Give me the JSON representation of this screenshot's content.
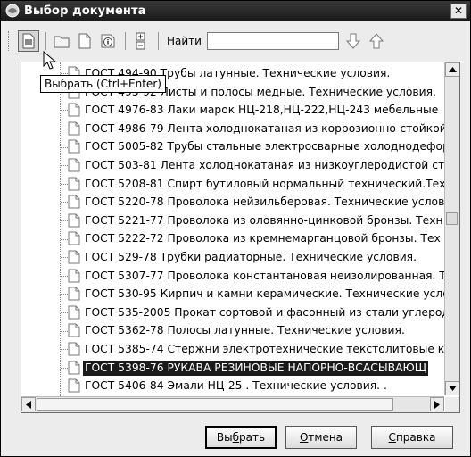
{
  "window": {
    "title": "Выбор документа",
    "close_label": "✕"
  },
  "toolbar": {
    "find_label": "Найти",
    "find_value": "",
    "icons": [
      "select-doc-icon",
      "folder-icon",
      "new-doc-icon",
      "info-icon",
      "expand-collapse-icon",
      "arrow-down-icon",
      "arrow-up-icon"
    ]
  },
  "tooltip": {
    "text": "Выбрать (Ctrl+Enter)"
  },
  "list": {
    "items": [
      {
        "label": "ГОСТ 494-90 Трубы латунные. Технические условия.",
        "selected": false
      },
      {
        "label": "ГОСТ 495-92 Листы и полосы медные. Технические условия.",
        "selected": false
      },
      {
        "label": "ГОСТ 4976-83 Лаки марок НЦ-218,НЦ-222,НЦ-243 мебельные",
        "selected": false
      },
      {
        "label": "ГОСТ 4986-79 Лента холоднокатаная из коррозионно-стойкой",
        "selected": false
      },
      {
        "label": "ГОСТ 5005-82 Трубы стальные электросварные холоднодефор",
        "selected": false
      },
      {
        "label": "ГОСТ 503-81 Лента холоднокатаная из низкоуглеродистой ста",
        "selected": false
      },
      {
        "label": "ГОСТ 5208-81 Спирт бутиловый нормальный технический.Техн",
        "selected": false
      },
      {
        "label": "ГОСТ 5220-78 Проволока нейзильберовая. Технические услов",
        "selected": false
      },
      {
        "label": "ГОСТ 5221-77 Проволока из оловянно-цинковой бронзы. Техн",
        "selected": false
      },
      {
        "label": "ГОСТ 5222-72 Проволока из кремнемарганцовой бронзы. Тех",
        "selected": false
      },
      {
        "label": "ГОСТ 529-78 Трубки радиаторные. Технические условия.",
        "selected": false
      },
      {
        "label": "ГОСТ 5307-77 Проволока константановая неизолированная. Т",
        "selected": false
      },
      {
        "label": "ГОСТ 530-95 Кирпич и камни керамические. Технические усло",
        "selected": false
      },
      {
        "label": "ГОСТ 535-2005 Прокат сортовой и фасонный из стали углерод",
        "selected": false
      },
      {
        "label": "ГОСТ 5362-78 Полосы латунные. Технические условия.",
        "selected": false
      },
      {
        "label": "ГОСТ 5385-74 Стержни электротехнические текстолитовые кр",
        "selected": false
      },
      {
        "label": "ГОСТ 5398-76 РУКАВА РЕЗИНОВЫЕ НАПОРНО-ВСАСЫВАЮЩ",
        "selected": true
      },
      {
        "label": "ГОСТ 5406-84 Эмали НЦ-25 . Технические условия. .",
        "selected": false
      }
    ]
  },
  "buttons": {
    "select": {
      "pre": "Вы",
      "accel": "б",
      "post": "рать"
    },
    "cancel": {
      "pre": "",
      "accel": "О",
      "post": "тмена"
    },
    "help": {
      "pre": "",
      "accel": "С",
      "post": "правка"
    }
  },
  "colors": {
    "titlebar": "#2a2a2a",
    "selection": "#1a1a1a",
    "dialog_bg": "#ececec"
  }
}
